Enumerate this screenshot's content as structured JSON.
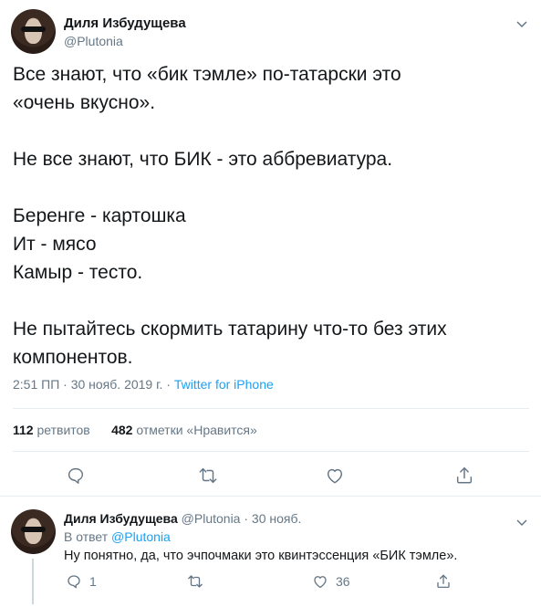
{
  "main_tweet": {
    "author_name": "Диля Избудущева",
    "author_handle": "@Plutonia",
    "lines": [
      "Все знают, что «бик тэмле» по-татарски это",
      "«очень вкусно».",
      "",
      "Не все знают, что БИК - это аббревиатура.",
      "",
      "Беренге - картошка",
      "Ит - мясо",
      "Камыр - тесто.",
      "",
      "Не пытайтесь скормить татарину что-то без этих",
      "компонентов."
    ],
    "timestamp": "2:51 ПП · 30 нояб. 2019 г. · ",
    "source": "Twitter for iPhone",
    "retweets_count": "112",
    "retweets_label": "ретвитов",
    "likes_count": "482",
    "likes_label": "отметки «Нравится»"
  },
  "reply_tweet": {
    "author_name": "Диля Избудущева",
    "author_handle": "@Plutonia",
    "date": "· 30 нояб.",
    "replying_to_label": "В ответ",
    "replying_to_handle": "@Plutonia",
    "text": "Ну понятно, да, что эчпочмаки это квинтэссенция «БИК тэмле».",
    "reply_count": "1",
    "retweet_count": "",
    "like_count": "36"
  },
  "colors": {
    "text": "#14171a",
    "secondary": "#657786",
    "accent": "#1da1f2",
    "divider": "#e6ecf0"
  },
  "icons": [
    "chevron-down-icon",
    "reply-icon",
    "retweet-icon",
    "like-icon",
    "share-icon"
  ]
}
